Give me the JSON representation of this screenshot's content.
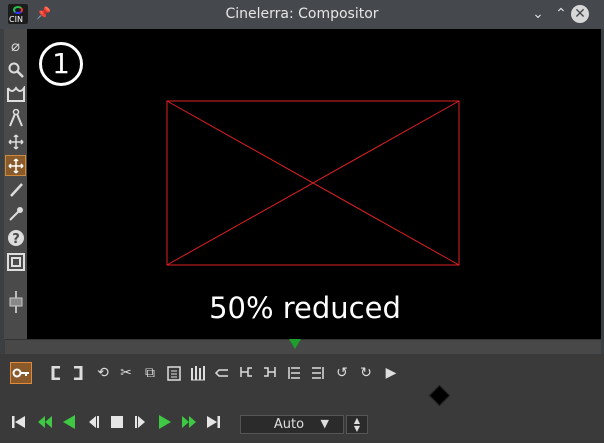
{
  "window": {
    "title": "Cinelerra: Compositor",
    "logo_text": "CIN",
    "controls": {
      "minimize": "⌄",
      "maximize": "⌃",
      "close": "✕"
    }
  },
  "canvas": {
    "overlay_number": "1",
    "caption": "50% reduced",
    "frame_color": "#e02020",
    "background": "#000000"
  },
  "left_tools": [
    {
      "name": "protect-video-icon",
      "glyph": "⌀"
    },
    {
      "name": "zoom-icon",
      "glyph": "🔍"
    },
    {
      "name": "mask-icon",
      "glyph": "⊠"
    },
    {
      "name": "ruler-icon",
      "glyph": "Å"
    },
    {
      "name": "camera-icon",
      "glyph": "✥"
    },
    {
      "name": "projector-icon",
      "glyph": "✥"
    },
    {
      "name": "crop-icon",
      "glyph": "✎"
    },
    {
      "name": "eyedropper-icon",
      "glyph": "✒"
    },
    {
      "name": "help-icon",
      "glyph": "?"
    },
    {
      "name": "safe-region-icon",
      "glyph": "▣"
    },
    {
      "name": "slider-icon",
      "glyph": "⊟"
    }
  ],
  "edit_buttons": [
    {
      "name": "keyframe-lock-icon",
      "glyph": "⚷",
      "active": true
    },
    {
      "name": "in-point-icon",
      "glyph": "["
    },
    {
      "name": "out-point-icon",
      "glyph": "]"
    },
    {
      "name": "loop-icon",
      "glyph": "⟲"
    },
    {
      "name": "cut-icon",
      "glyph": "✂"
    },
    {
      "name": "copy-icon",
      "glyph": "⧉"
    },
    {
      "name": "paste-icon",
      "glyph": "📋"
    },
    {
      "name": "splice-icon",
      "glyph": "⫼"
    },
    {
      "name": "label-icon",
      "glyph": "⊏"
    },
    {
      "name": "prev-label-icon",
      "glyph": "⊏"
    },
    {
      "name": "next-label-icon",
      "glyph": "⊐"
    },
    {
      "name": "prev-edit-icon",
      "glyph": "⊨"
    },
    {
      "name": "next-edit-icon",
      "glyph": "⊫"
    },
    {
      "name": "undo-icon",
      "glyph": "↺"
    },
    {
      "name": "redo-icon",
      "glyph": "↻"
    },
    {
      "name": "more-icon",
      "glyph": "▶"
    }
  ],
  "transport": [
    {
      "name": "rewind-icon",
      "glyph": "⏮"
    },
    {
      "name": "fast-reverse-icon",
      "glyph": "⏪",
      "green": true
    },
    {
      "name": "reverse-play-icon",
      "glyph": "◀",
      "green": true
    },
    {
      "name": "frame-back-icon",
      "glyph": "◁"
    },
    {
      "name": "stop-icon",
      "glyph": "■"
    },
    {
      "name": "frame-forward-icon",
      "glyph": "▷"
    },
    {
      "name": "play-icon",
      "glyph": "▶",
      "green": true
    },
    {
      "name": "fast-forward-icon",
      "glyph": "⏩",
      "green": true
    },
    {
      "name": "end-icon",
      "glyph": "⏭"
    }
  ],
  "zoom": {
    "value": "Auto",
    "arrow": "▼",
    "spin_up": "▲",
    "spin_down": "▼"
  }
}
